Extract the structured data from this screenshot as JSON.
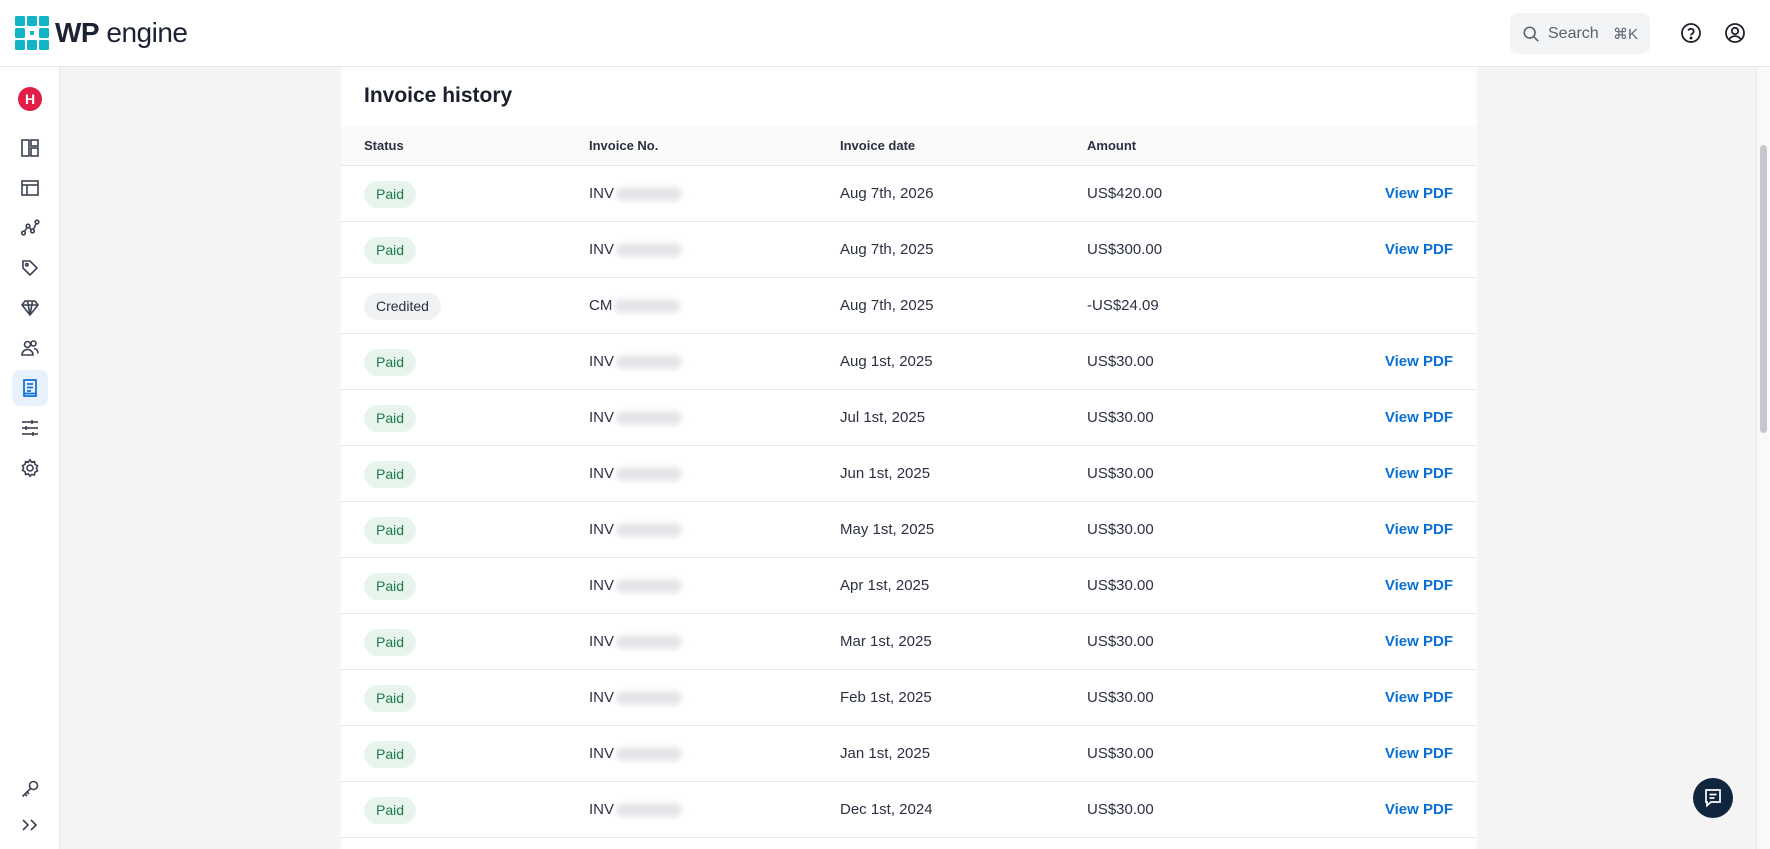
{
  "brand": {
    "logo_bold": "WP",
    "logo_rest": "engine",
    "tile_color": "#10b5c6"
  },
  "header": {
    "search_label": "Search",
    "search_shortcut": "⌘K"
  },
  "account": {
    "initial": "H",
    "color": "#e11d48"
  },
  "sidebar": {
    "items": [
      {
        "icon": "dashboard-icon",
        "active": false
      },
      {
        "icon": "layout-icon",
        "active": false
      },
      {
        "icon": "analytics-icon",
        "active": false
      },
      {
        "icon": "tag-icon",
        "active": false
      },
      {
        "icon": "diamond-icon",
        "active": false
      },
      {
        "icon": "users-icon",
        "active": false
      },
      {
        "icon": "billing-icon",
        "active": true
      },
      {
        "icon": "sliders-icon",
        "active": false
      },
      {
        "icon": "gear-icon",
        "active": false
      }
    ],
    "bottom": [
      "key-icon",
      "expand-icon"
    ]
  },
  "invoices": {
    "title": "Invoice history",
    "columns": {
      "status": "Status",
      "number": "Invoice No.",
      "date": "Invoice date",
      "amount": "Amount"
    },
    "link_label": "View PDF",
    "rows": [
      {
        "status": "Paid",
        "number_prefix": "INV",
        "date": "Aug 7th, 2026",
        "amount": "US$420.00",
        "has_pdf": true
      },
      {
        "status": "Paid",
        "number_prefix": "INV",
        "date": "Aug 7th, 2025",
        "amount": "US$300.00",
        "has_pdf": true
      },
      {
        "status": "Credited",
        "number_prefix": "CM",
        "date": "Aug 7th, 2025",
        "amount": "-US$24.09",
        "has_pdf": false
      },
      {
        "status": "Paid",
        "number_prefix": "INV",
        "date": "Aug 1st, 2025",
        "amount": "US$30.00",
        "has_pdf": true
      },
      {
        "status": "Paid",
        "number_prefix": "INV",
        "date": "Jul 1st, 2025",
        "amount": "US$30.00",
        "has_pdf": true
      },
      {
        "status": "Paid",
        "number_prefix": "INV",
        "date": "Jun 1st, 2025",
        "amount": "US$30.00",
        "has_pdf": true
      },
      {
        "status": "Paid",
        "number_prefix": "INV",
        "date": "May 1st, 2025",
        "amount": "US$30.00",
        "has_pdf": true
      },
      {
        "status": "Paid",
        "number_prefix": "INV",
        "date": "Apr 1st, 2025",
        "amount": "US$30.00",
        "has_pdf": true
      },
      {
        "status": "Paid",
        "number_prefix": "INV",
        "date": "Mar 1st, 2025",
        "amount": "US$30.00",
        "has_pdf": true
      },
      {
        "status": "Paid",
        "number_prefix": "INV",
        "date": "Feb 1st, 2025",
        "amount": "US$30.00",
        "has_pdf": true
      },
      {
        "status": "Paid",
        "number_prefix": "INV",
        "date": "Jan 1st, 2025",
        "amount": "US$30.00",
        "has_pdf": true
      },
      {
        "status": "Paid",
        "number_prefix": "INV",
        "date": "Dec 1st, 2024",
        "amount": "US$30.00",
        "has_pdf": true
      }
    ]
  },
  "chat": {
    "icon": "chat-icon"
  }
}
